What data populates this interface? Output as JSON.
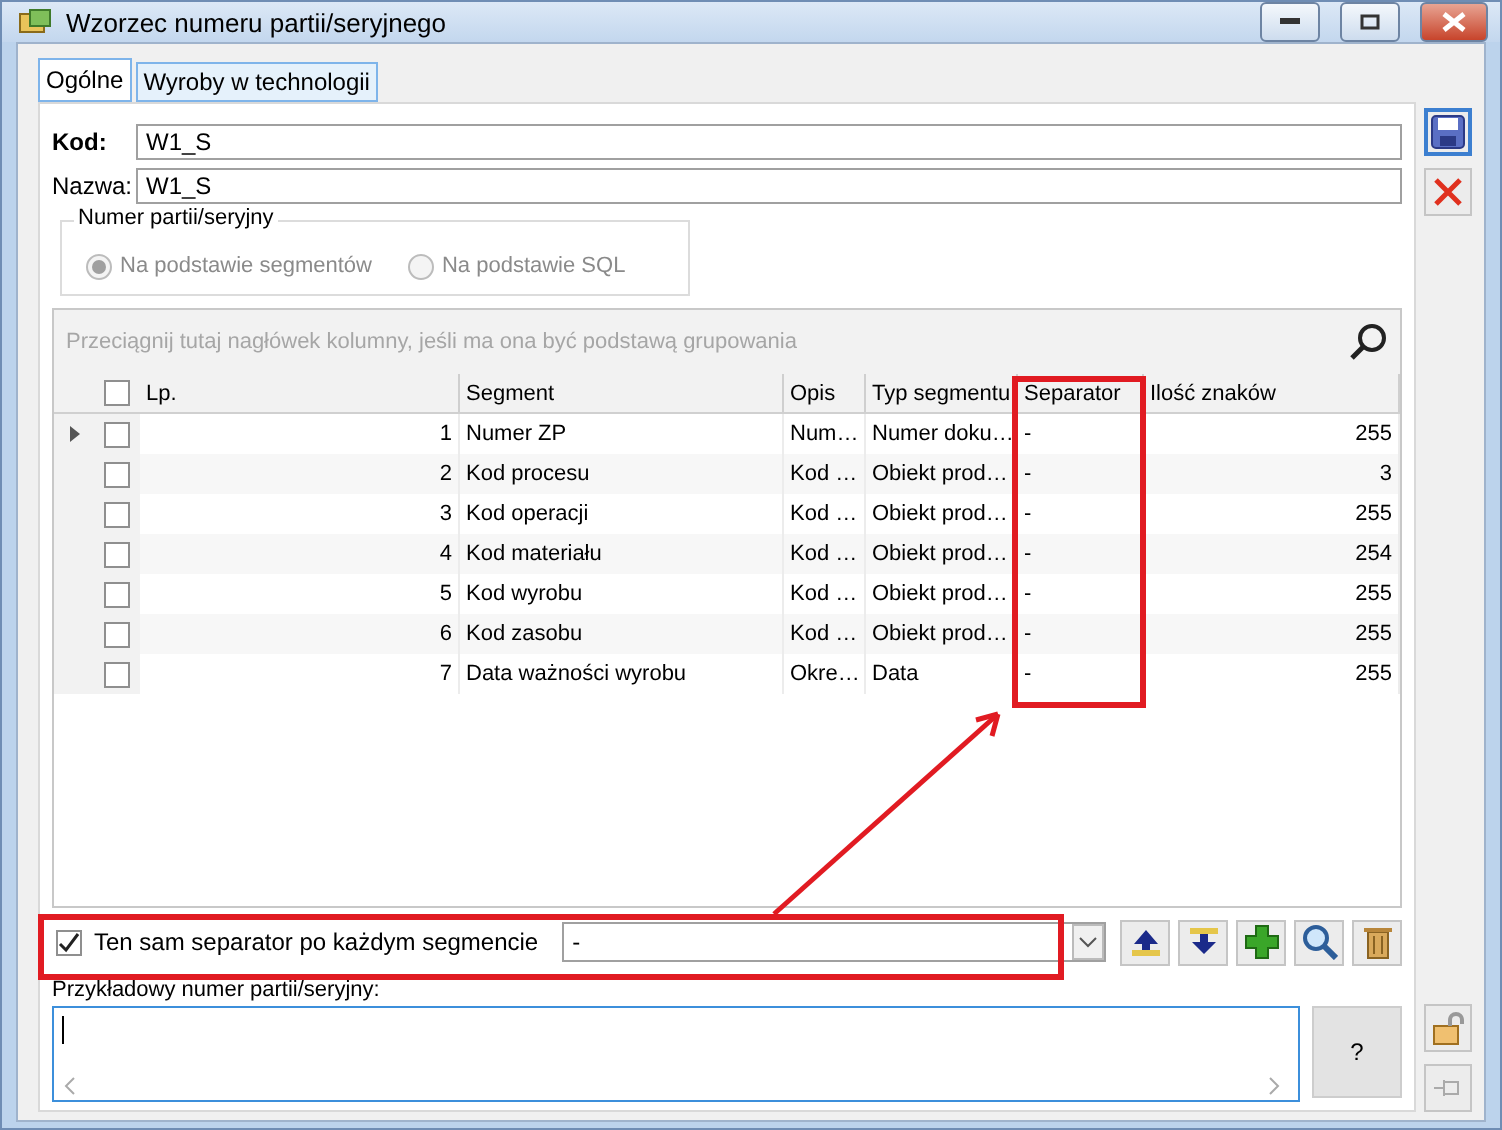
{
  "window": {
    "title": "Wzorzec numeru partii/seryjnego"
  },
  "tabs": [
    {
      "label": "Ogólne",
      "selected": true
    },
    {
      "label": "Wyroby w technologii",
      "selected": false
    }
  ],
  "fields": [
    {
      "label": "Kod:",
      "value": "W1_S",
      "bold": true
    },
    {
      "label": "Nazwa:",
      "value": "W1_S",
      "bold": false
    }
  ],
  "number_group": {
    "title": "Numer partii/seryjny",
    "disabled": true,
    "options": [
      {
        "label": "Na podstawie segmentów",
        "selected": true
      },
      {
        "label": "Na podstawie SQL",
        "selected": false
      }
    ]
  },
  "grid": {
    "group_hint": "Przeciągnij tutaj nagłówek kolumny, jeśli ma ona być podstawą grupowania",
    "all_checked": false,
    "columns": [
      "Lp.",
      "Segment",
      "Opis",
      "Typ segmentu",
      "Separator",
      "Ilość znaków"
    ],
    "rows": [
      {
        "selected": true,
        "checked": false,
        "cells": [
          "1",
          "Numer ZP",
          "Num…",
          "Numer doku…",
          "-",
          "255"
        ]
      },
      {
        "selected": false,
        "checked": false,
        "cells": [
          "2",
          "Kod procesu",
          "Kod …",
          "Obiekt prod…",
          "-",
          "3"
        ]
      },
      {
        "selected": false,
        "checked": false,
        "cells": [
          "3",
          "Kod operacji",
          "Kod …",
          "Obiekt prod…",
          "-",
          "255"
        ]
      },
      {
        "selected": false,
        "checked": false,
        "cells": [
          "4",
          "Kod materiału",
          "Kod …",
          "Obiekt prod…",
          "-",
          "254"
        ]
      },
      {
        "selected": false,
        "checked": false,
        "cells": [
          "5",
          "Kod wyrobu",
          "Kod …",
          "Obiekt prod…",
          "-",
          "255"
        ]
      },
      {
        "selected": false,
        "checked": false,
        "cells": [
          "6",
          "Kod zasobu",
          "Kod …",
          "Obiekt prod…",
          "-",
          "255"
        ]
      },
      {
        "selected": false,
        "checked": false,
        "cells": [
          "7",
          "Data ważności wyrobu",
          "Okre…",
          "Data",
          "-",
          "255"
        ]
      }
    ]
  },
  "same_separator": {
    "label": "Ten sam separator po każdym segmencie",
    "checked": true,
    "value": "-"
  },
  "example": {
    "label": "Przykładowy numer partii/seryjny:"
  },
  "help_button": "?"
}
